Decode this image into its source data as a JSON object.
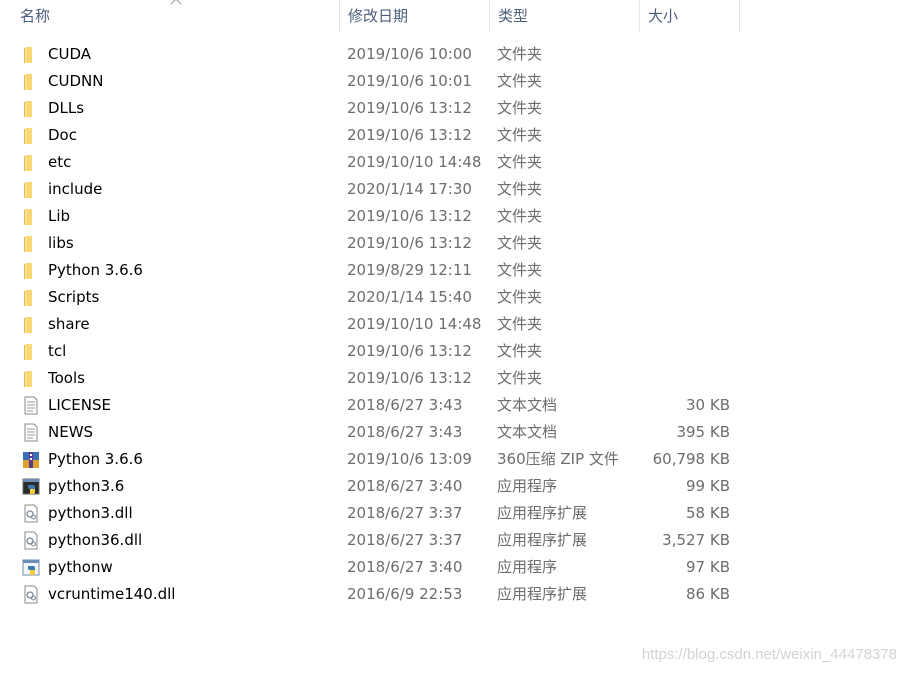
{
  "header": {
    "name": "名称",
    "date": "修改日期",
    "type": "类型",
    "size": "大小",
    "sort_indicator": "chevron-up-icon"
  },
  "files": [
    {
      "name": "CUDA",
      "date": "2019/10/6 10:00",
      "type": "文件夹",
      "size": "",
      "icon": "folder"
    },
    {
      "name": "CUDNN",
      "date": "2019/10/6 10:01",
      "type": "文件夹",
      "size": "",
      "icon": "folder"
    },
    {
      "name": "DLLs",
      "date": "2019/10/6 13:12",
      "type": "文件夹",
      "size": "",
      "icon": "folder"
    },
    {
      "name": "Doc",
      "date": "2019/10/6 13:12",
      "type": "文件夹",
      "size": "",
      "icon": "folder"
    },
    {
      "name": "etc",
      "date": "2019/10/10 14:48",
      "type": "文件夹",
      "size": "",
      "icon": "folder"
    },
    {
      "name": "include",
      "date": "2020/1/14 17:30",
      "type": "文件夹",
      "size": "",
      "icon": "folder"
    },
    {
      "name": "Lib",
      "date": "2019/10/6 13:12",
      "type": "文件夹",
      "size": "",
      "icon": "folder"
    },
    {
      "name": "libs",
      "date": "2019/10/6 13:12",
      "type": "文件夹",
      "size": "",
      "icon": "folder"
    },
    {
      "name": "Python 3.6.6",
      "date": "2019/8/29 12:11",
      "type": "文件夹",
      "size": "",
      "icon": "folder"
    },
    {
      "name": "Scripts",
      "date": "2020/1/14 15:40",
      "type": "文件夹",
      "size": "",
      "icon": "folder"
    },
    {
      "name": "share",
      "date": "2019/10/10 14:48",
      "type": "文件夹",
      "size": "",
      "icon": "folder"
    },
    {
      "name": "tcl",
      "date": "2019/10/6 13:12",
      "type": "文件夹",
      "size": "",
      "icon": "folder"
    },
    {
      "name": "Tools",
      "date": "2019/10/6 13:12",
      "type": "文件夹",
      "size": "",
      "icon": "folder"
    },
    {
      "name": "LICENSE",
      "date": "2018/6/27 3:43",
      "type": "文本文档",
      "size": "30 KB",
      "icon": "text"
    },
    {
      "name": "NEWS",
      "date": "2018/6/27 3:43",
      "type": "文本文档",
      "size": "395 KB",
      "icon": "text"
    },
    {
      "name": "Python 3.6.6",
      "date": "2019/10/6 13:09",
      "type": "360压缩 ZIP 文件",
      "size": "60,798 KB",
      "icon": "zip"
    },
    {
      "name": "python3.6",
      "date": "2018/6/27 3:40",
      "type": "应用程序",
      "size": "99 KB",
      "icon": "python-exe"
    },
    {
      "name": "python3.dll",
      "date": "2018/6/27 3:37",
      "type": "应用程序扩展",
      "size": "58 KB",
      "icon": "dll"
    },
    {
      "name": "python36.dll",
      "date": "2018/6/27 3:37",
      "type": "应用程序扩展",
      "size": "3,527 KB",
      "icon": "dll"
    },
    {
      "name": "pythonw",
      "date": "2018/6/27 3:40",
      "type": "应用程序",
      "size": "97 KB",
      "icon": "pythonw-exe"
    },
    {
      "name": "vcruntime140.dll",
      "date": "2016/6/9 22:53",
      "type": "应用程序扩展",
      "size": "86 KB",
      "icon": "dll"
    }
  ],
  "watermark": "https://blog.csdn.net/weixin_44478378",
  "colors": {
    "header_text": "#4c607a",
    "meta_text": "#6d6d6d",
    "folder": "#f8d775"
  }
}
